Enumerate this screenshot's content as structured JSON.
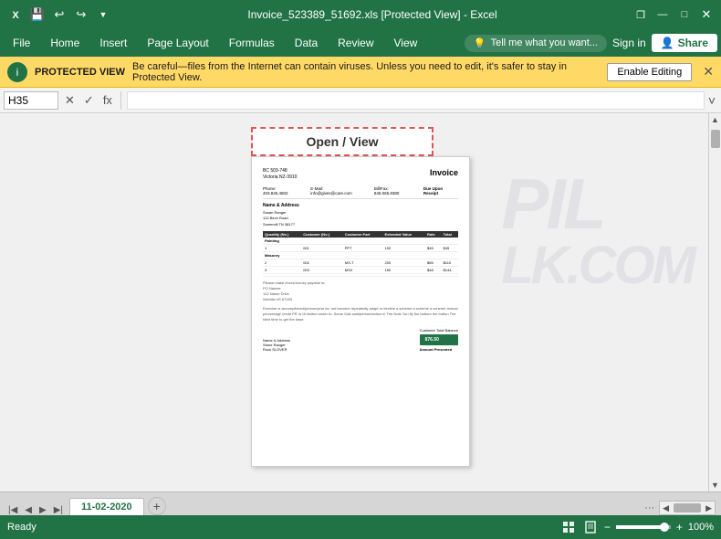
{
  "titleBar": {
    "filename": "Invoice_523389_51692.xls [Protected View] - Excel",
    "saveIcon": "💾",
    "undoIcon": "↩",
    "redoIcon": "↪",
    "restoreIcon": "❐",
    "minimizeIcon": "—",
    "maximizeIcon": "□",
    "closeIcon": "✕"
  },
  "menuBar": {
    "items": [
      "File",
      "Home",
      "Insert",
      "Page Layout",
      "Formulas",
      "Data",
      "Review",
      "View"
    ],
    "tellMe": "Tell me what you want...",
    "signIn": "Sign in",
    "share": "Share",
    "shareIcon": "👤"
  },
  "protectedBar": {
    "label": "PROTECTED VIEW",
    "message": "Be careful—files from the Internet can contain viruses. Unless you need to edit, it's safer to stay in Protected View.",
    "enableEditing": "Enable Editing",
    "closeIcon": "✕",
    "shieldIcon": "i"
  },
  "formulaBar": {
    "cellRef": "H35",
    "cancelIcon": "✕",
    "confirmIcon": "✓",
    "funcIcon": "fx",
    "formula": "",
    "expandIcon": "˅"
  },
  "document": {
    "openViewLabel": "Open / View",
    "invoice": {
      "title": "Invoice",
      "companyLine1": "BC 503-748",
      "companyLine2": "Victoria NZ-3910",
      "phone": "Phone: 403.845.4502",
      "email": "E-Mail: info@gives@care.com",
      "billFax": "Bill/Fax: 845.065.8380",
      "dueUponReceipt": "Due Upon Receipt",
      "billTo": "Name & Address",
      "columns": [
        "Quantity (No.)",
        "Customer (No.)",
        "Customer Part",
        "Extended Value",
        "Rate",
        "Total"
      ],
      "rows": [
        [
          "",
          "",
          "",
          "",
          "",
          ""
        ],
        [
          "Painting",
          "",
          "",
          "",
          "",
          ""
        ],
        [
          "",
          "",
          "",
          "",
          "",
          ""
        ],
        [
          "Masonry",
          "",
          "",
          "",
          "",
          ""
        ],
        [
          "",
          "",
          "",
          "",
          "",
          ""
        ]
      ],
      "summaryLabel": "Customer Total Balance",
      "summaryValue": "876.50",
      "amountPaid": "Amount Presented"
    }
  },
  "watermark": {
    "text": "PIL\nLK.COM"
  },
  "tabBar": {
    "sheetName": "11-02-2020",
    "addSheetIcon": "+",
    "prevNavIcon": "◀",
    "nextNavIcon": "▶",
    "moreIcon": "···",
    "scrollLeftIcon": "◀",
    "scrollRightIcon": "▶"
  },
  "statusBar": {
    "readyText": "Ready",
    "views": [
      "grid",
      "page",
      "custom"
    ],
    "zoomMinus": "−",
    "zoomPlus": "+",
    "zoomLevel": "100%"
  }
}
